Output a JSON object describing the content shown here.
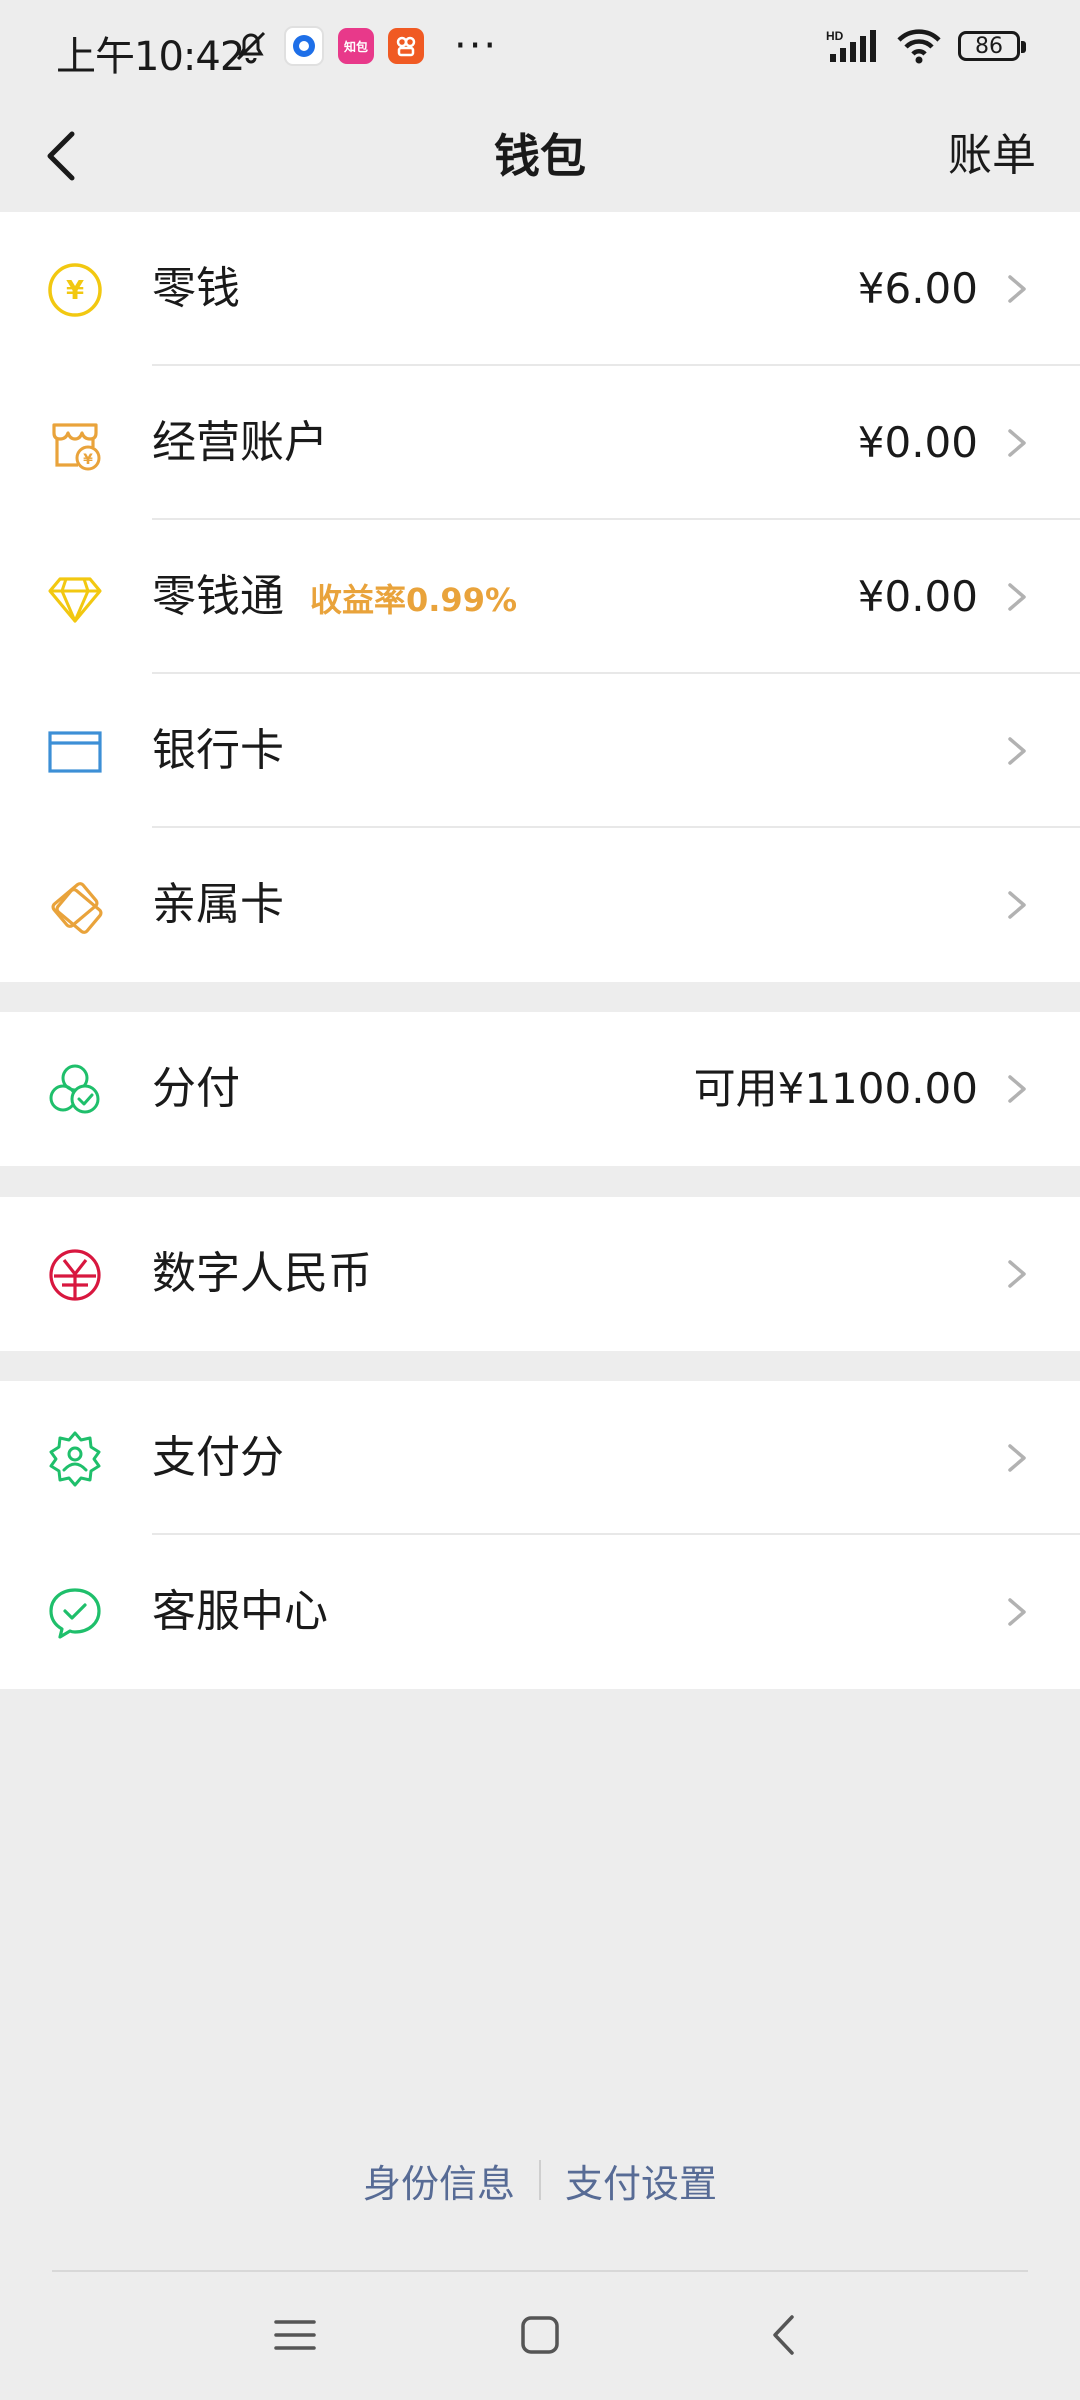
{
  "status_bar": {
    "time": "上午10:42",
    "apps": [
      {
        "icon": "blue-app-icon",
        "color": "#1e6fe8"
      },
      {
        "icon": "pink-app-icon",
        "color": "#e8398a",
        "label": "知包"
      },
      {
        "icon": "orange-app-icon",
        "color": "#f05a23"
      }
    ],
    "more": "···",
    "hd_label": "HD",
    "battery": "86"
  },
  "nav": {
    "title": "钱包",
    "action": "账单"
  },
  "groups": [
    {
      "rows": [
        {
          "id": "change",
          "label": "零钱",
          "value": "¥6.00",
          "icon": "yuan-coin-icon"
        },
        {
          "id": "business",
          "label": "经营账户",
          "value": "¥0.00",
          "icon": "shop-icon"
        },
        {
          "id": "lqt",
          "label": "零钱通",
          "badge": "收益率0.99%",
          "value": "¥0.00",
          "icon": "diamond-icon"
        },
        {
          "id": "bank",
          "label": "银行卡",
          "icon": "bank-card-icon"
        },
        {
          "id": "family",
          "label": "亲属卡",
          "icon": "family-card-icon"
        }
      ]
    },
    {
      "rows": [
        {
          "id": "fenfu",
          "label": "分付",
          "value": "可用¥1100.00",
          "icon": "fenfu-icon"
        }
      ]
    },
    {
      "rows": [
        {
          "id": "ecny",
          "label": "数字人民币",
          "icon": "digital-rmb-icon"
        }
      ]
    },
    {
      "rows": [
        {
          "id": "score",
          "label": "支付分",
          "icon": "pay-score-icon"
        },
        {
          "id": "service",
          "label": "客服中心",
          "icon": "customer-service-icon"
        }
      ]
    }
  ],
  "footer": {
    "identity": "身份信息",
    "settings": "支付设置"
  },
  "colors": {
    "yellow": "#f2c811",
    "orange": "#e9a33b",
    "blue": "#3d8fd6",
    "green": "#1fbf6b",
    "red": "#d8173f",
    "link": "#576b95"
  }
}
